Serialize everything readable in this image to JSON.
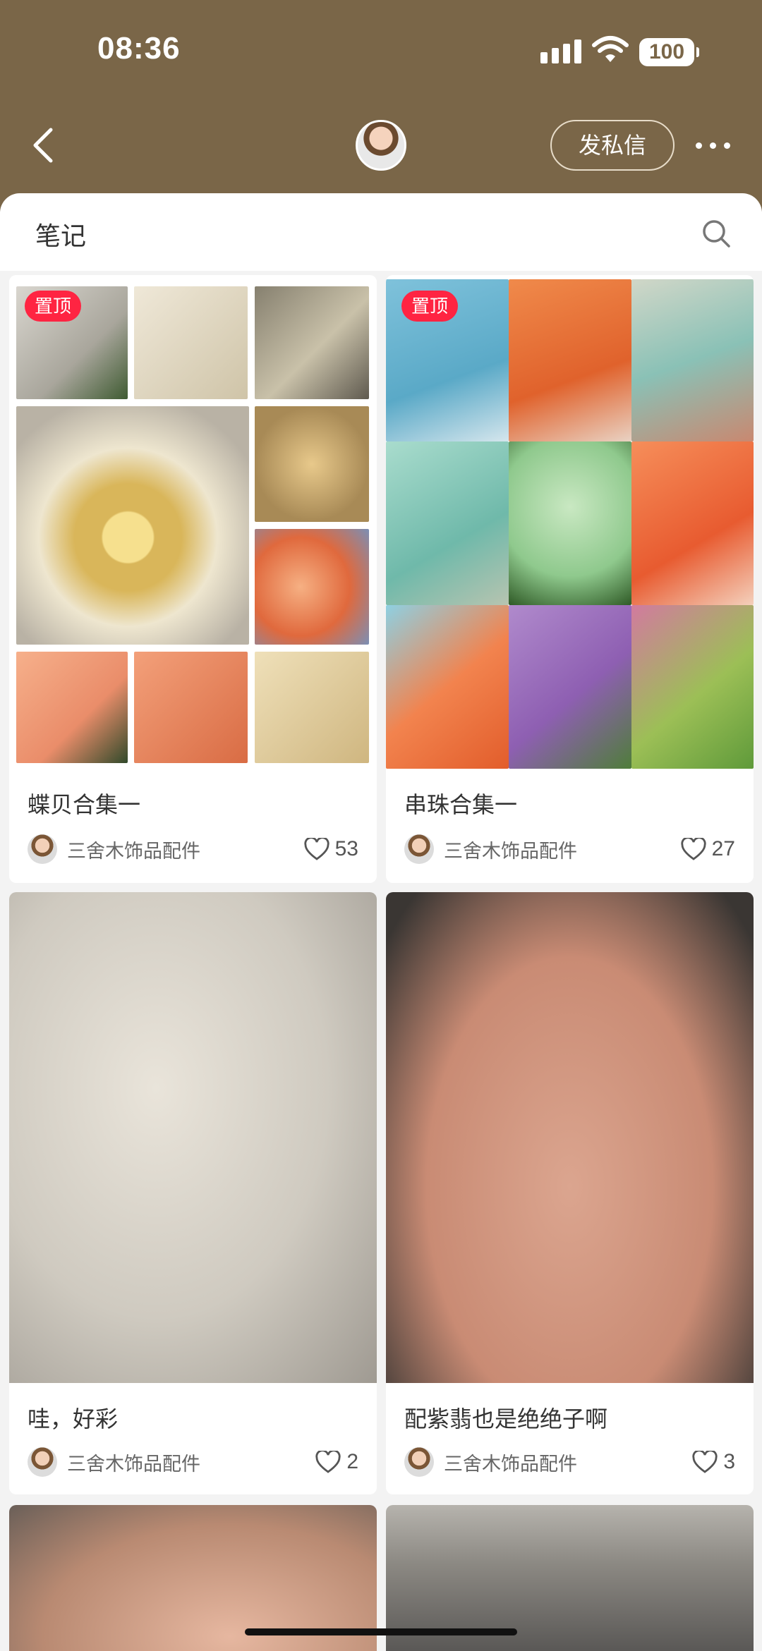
{
  "status": {
    "time": "08:36",
    "battery": "100"
  },
  "header": {
    "dm_label": "发私信"
  },
  "notes": {
    "title": "笔记"
  },
  "feed": [
    {
      "pin": "置顶",
      "title": "蝶贝合集一",
      "author": "三舍木饰品配件",
      "likes": "53"
    },
    {
      "pin": "置顶",
      "title": "串珠合集一",
      "author": "三舍木饰品配件",
      "likes": "27"
    },
    {
      "title": "哇，好彩",
      "author": "三舍木饰品配件",
      "likes": "2"
    },
    {
      "title": "配紫翡也是绝绝子啊",
      "author": "三舍木饰品配件",
      "likes": "3"
    }
  ]
}
